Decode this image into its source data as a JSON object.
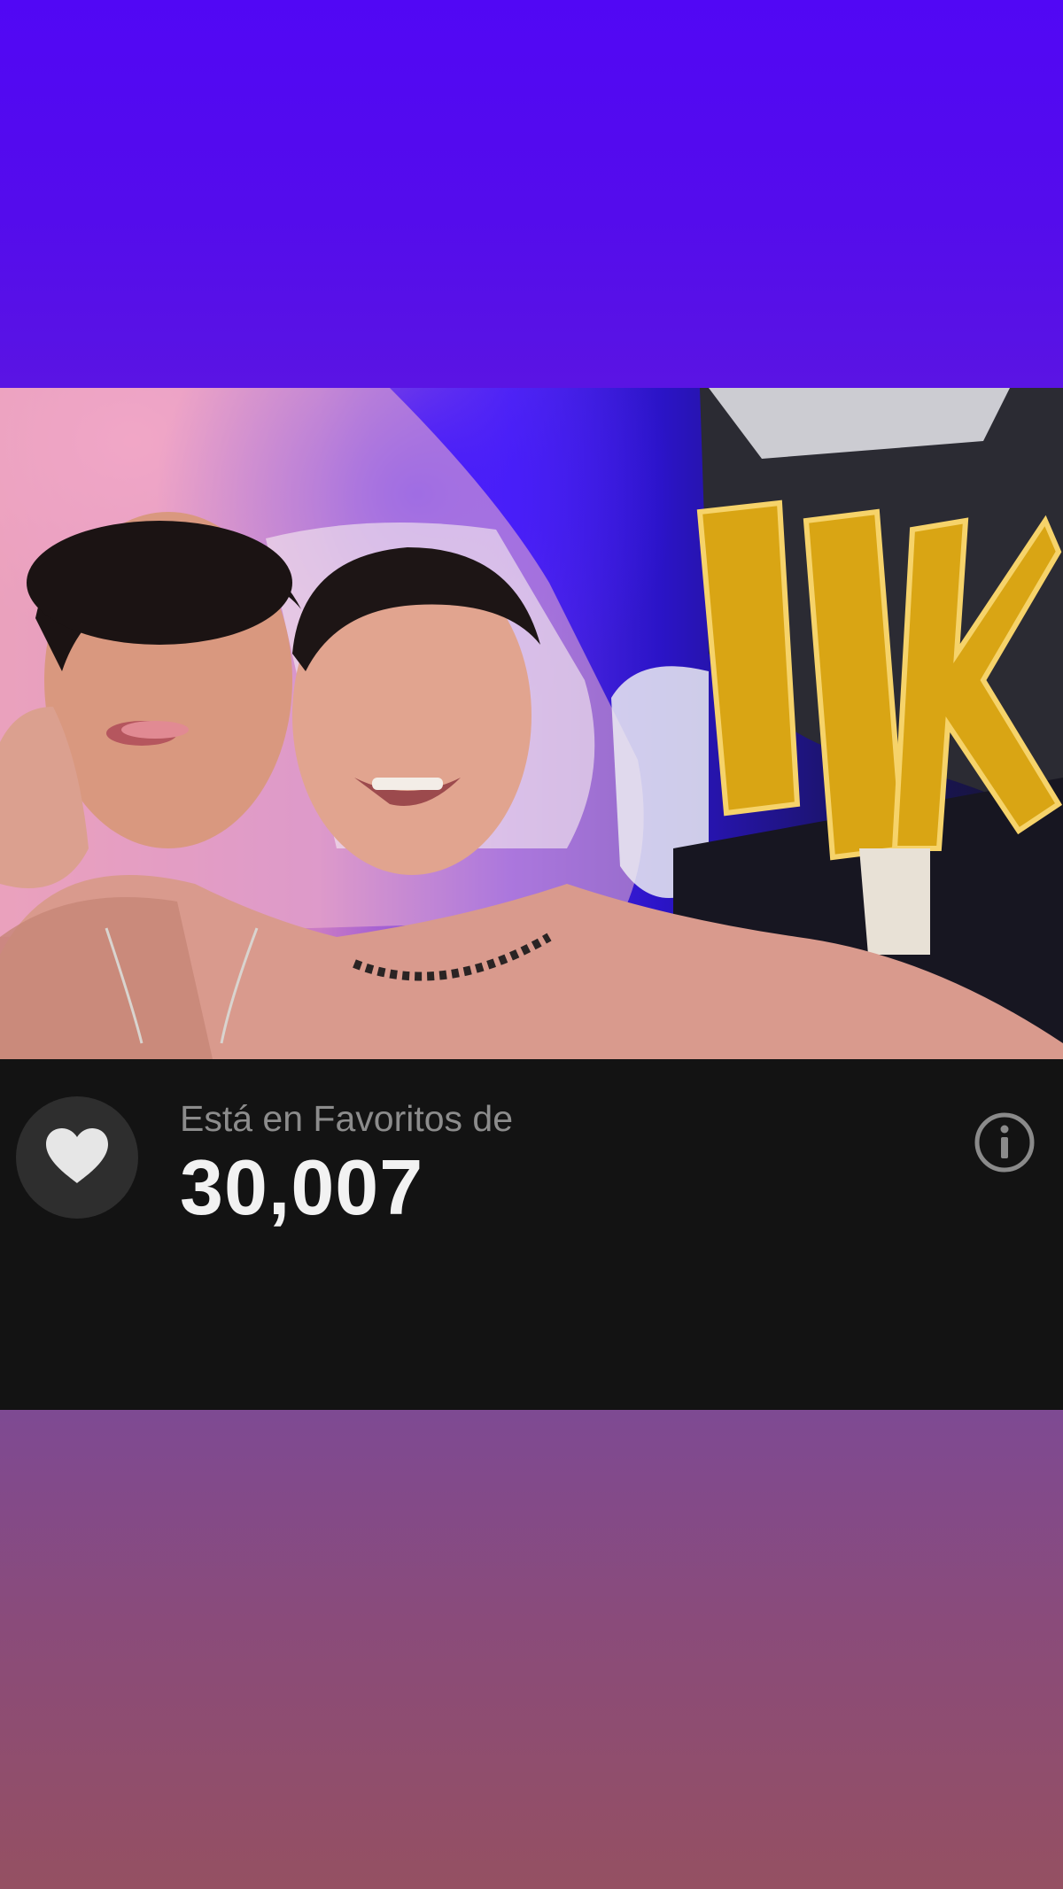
{
  "photo": {
    "alt": "Foto de perfil"
  },
  "favorites": {
    "caption": "Está en Favoritos de",
    "count": "30,007"
  },
  "icons": {
    "heart": "heart-icon",
    "info": "info-icon"
  },
  "colors": {
    "top_background": "#5107f5",
    "info_bar_background": "#131313",
    "heart_button_background": "#2e2e2e",
    "caption_text": "#8c8c8c",
    "count_text": "#f2f2f2",
    "bottom_background": "#8a4b7a"
  }
}
